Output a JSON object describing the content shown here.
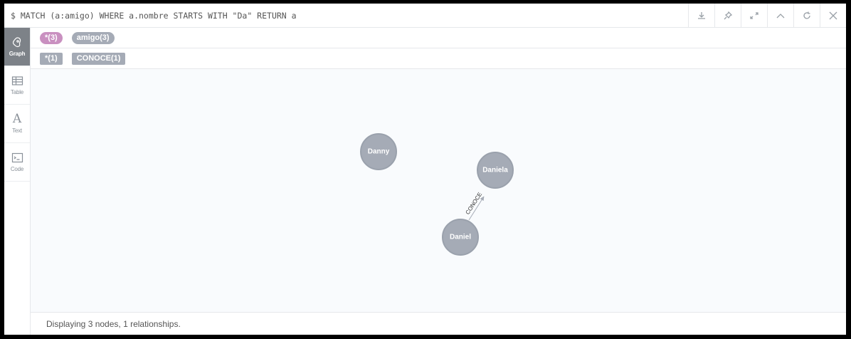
{
  "query": {
    "text": "$ MATCH (a:amigo) WHERE a.nombre STARTS WITH \"Da\" RETURN a"
  },
  "toolbar": {
    "buttons": [
      {
        "name": "download-icon"
      },
      {
        "name": "pin-icon"
      },
      {
        "name": "expand-icon"
      },
      {
        "name": "collapse-up-icon"
      },
      {
        "name": "rerun-icon"
      },
      {
        "name": "close-icon"
      }
    ]
  },
  "sidebar": {
    "tabs": [
      {
        "label": "Graph",
        "icon": "graph-icon",
        "active": true
      },
      {
        "label": "Table",
        "icon": "table-icon",
        "active": false
      },
      {
        "label": "Text",
        "icon": "text-icon",
        "active": false
      },
      {
        "label": "Code",
        "icon": "code-icon",
        "active": false
      }
    ]
  },
  "legend": {
    "labels": [
      {
        "text": "*(3)",
        "color": "#c990c0"
      },
      {
        "text": "amigo(3)",
        "color": "#a5abb6"
      }
    ],
    "relationships": [
      {
        "text": "*(1)",
        "color": "#a5abb6"
      },
      {
        "text": "CONOCE(1)",
        "color": "#a5abb6"
      }
    ]
  },
  "graph": {
    "nodes": [
      {
        "id": "danny",
        "label": "Danny"
      },
      {
        "id": "daniela",
        "label": "Daniela"
      },
      {
        "id": "daniel",
        "label": "Daniel"
      }
    ],
    "relationships": [
      {
        "from": "daniel",
        "to": "daniela",
        "type": "CONOCE"
      }
    ],
    "node_color": "#a5abb6",
    "canvas_background": "#f9fbfd"
  },
  "status": {
    "text": "Displaying 3 nodes, 1 relationships."
  }
}
